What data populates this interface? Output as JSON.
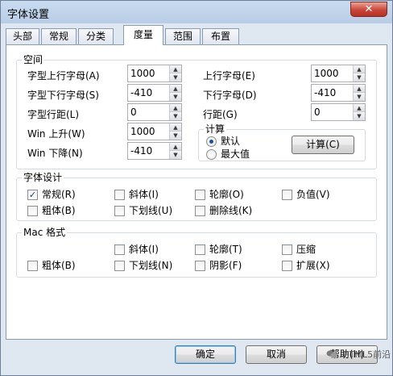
{
  "window": {
    "title": "字体设置",
    "close_glyph": "✕"
  },
  "tabs": [
    {
      "label": "头部",
      "active": false
    },
    {
      "label": "常规",
      "active": false
    },
    {
      "label": "分类",
      "active": false
    },
    {
      "label": "度量",
      "active": true
    },
    {
      "label": "范围",
      "active": false
    },
    {
      "label": "布置",
      "active": false
    }
  ],
  "space": {
    "title": "空间",
    "left": [
      {
        "label": "字型上行字母(A)",
        "value": "1000"
      },
      {
        "label": "字型下行字母(S)",
        "value": "-410"
      },
      {
        "label": "字型行距(L)",
        "value": "0"
      },
      {
        "label": "Win 上升(W)",
        "value": "1000"
      },
      {
        "label": "Win 下降(N)",
        "value": "-410"
      }
    ],
    "right": [
      {
        "label": "上行字母(E)",
        "value": "1000"
      },
      {
        "label": "下行字母(D)",
        "value": "-410"
      },
      {
        "label": "行距(G)",
        "value": "0"
      }
    ],
    "calc": {
      "title": "计算",
      "option_default": "默认",
      "option_max": "最大值",
      "selected": "默认",
      "button": "计算(C)"
    }
  },
  "design": {
    "title": "字体设计",
    "items": [
      {
        "label": "常规(R)",
        "checked": true
      },
      {
        "label": "斜体(I)",
        "checked": false
      },
      {
        "label": "轮廓(O)",
        "checked": false
      },
      {
        "label": "负值(V)",
        "checked": false
      },
      {
        "label": "粗体(B)",
        "checked": false
      },
      {
        "label": "下划线(U)",
        "checked": false
      },
      {
        "label": "删除线(K)",
        "checked": false
      }
    ]
  },
  "mac": {
    "title": "Mac 格式",
    "items": [
      {
        "label": "斜体(I)",
        "checked": false
      },
      {
        "label": "轮廓(T)",
        "checked": false
      },
      {
        "label": "压缩",
        "checked": false
      },
      {
        "label": "粗体(B)",
        "checked": false
      },
      {
        "label": "下划线(N)",
        "checked": false
      },
      {
        "label": "阴影(F)",
        "checked": false
      },
      {
        "label": "扩展(X)",
        "checked": false
      }
    ]
  },
  "buttons": {
    "ok": "确定",
    "cancel": "取消",
    "help": "帮助(H)"
  },
  "watermark": "HTML5前沿",
  "icons": {
    "arrow_up": "▲",
    "arrow_down": "▼",
    "check": "✓"
  }
}
